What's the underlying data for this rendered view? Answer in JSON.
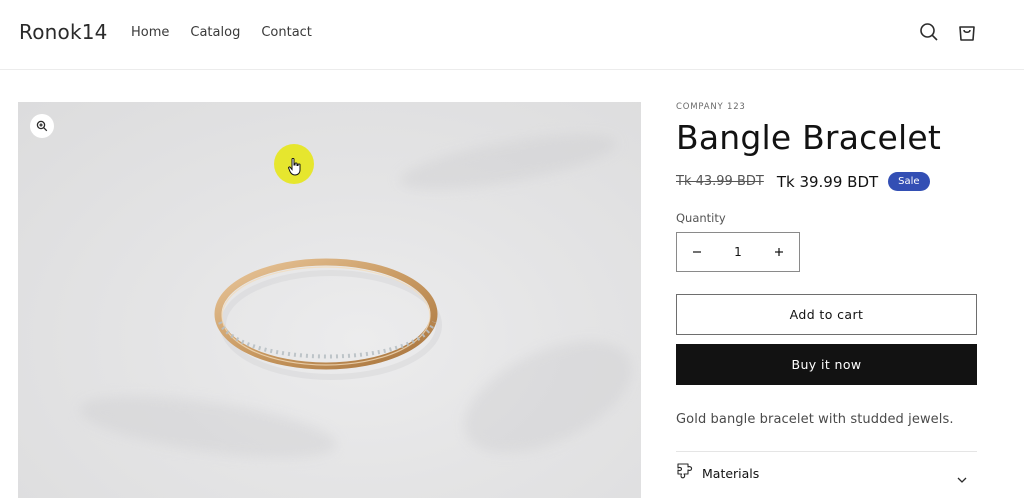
{
  "header": {
    "logo": "Ronok14",
    "nav": [
      "Home",
      "Catalog",
      "Contact"
    ]
  },
  "product": {
    "vendor": "COMPANY 123",
    "title": "Bangle Bracelet",
    "price_old": "Tk 43.99 BDT",
    "price_new": "Tk 39.99 BDT",
    "badge": "Sale",
    "quantity_label": "Quantity",
    "quantity_value": "1",
    "add_to_cart": "Add to cart",
    "buy_now": "Buy it now",
    "description": "Gold bangle bracelet with studded jewels.",
    "accordion_materials": "Materials"
  },
  "colors": {
    "badge": "#334fb4",
    "buy_button": "#121212",
    "cursor_highlight": "#e6e614"
  },
  "icons": [
    "search-icon",
    "cart-icon",
    "zoom-icon",
    "minus-icon",
    "plus-icon",
    "materials-icon",
    "chevron-down-icon"
  ]
}
